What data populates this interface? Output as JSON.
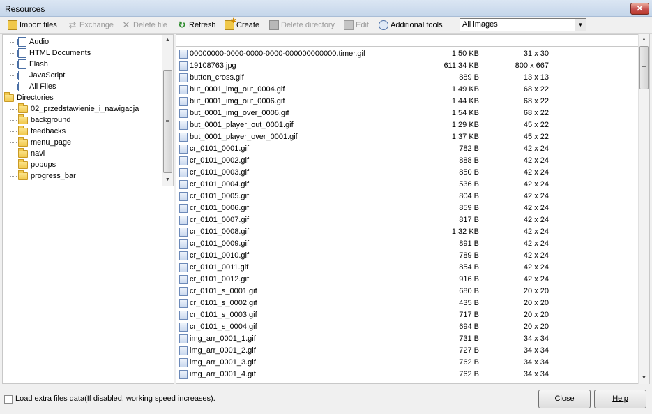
{
  "window": {
    "title": "Resources",
    "close_glyph": "✕"
  },
  "toolbar": {
    "import_files": "Import files",
    "exchange": "Exchange",
    "delete_file": "Delete file",
    "refresh": "Refresh",
    "create": "Create",
    "delete_directory": "Delete directory",
    "edit": "Edit",
    "additional_tools": "Additional tools",
    "filter": {
      "selected": "All images"
    }
  },
  "tree": {
    "file_types": [
      {
        "label": "Audio",
        "icon": "document-icon"
      },
      {
        "label": "HTML Documents",
        "icon": "document-icon"
      },
      {
        "label": "Flash",
        "icon": "document-icon"
      },
      {
        "label": "JavaScript",
        "icon": "document-icon"
      },
      {
        "label": "All Files",
        "icon": "document-icon"
      }
    ],
    "directories_label": "Directories",
    "directories": [
      "02_przedstawienie_i_nawigacja",
      "background",
      "feedbacks",
      "menu_page",
      "navi",
      "popups",
      "progress_bar"
    ]
  },
  "files": [
    {
      "name": "00000000-0000-0000-0000-000000000000.timer.gif",
      "size": "1.50 KB",
      "dims": "31 x 30"
    },
    {
      "name": "19108763.jpg",
      "size": "611.34 KB",
      "dims": "800 x 667"
    },
    {
      "name": "button_cross.gif",
      "size": "889 B",
      "dims": "13 x 13"
    },
    {
      "name": "but_0001_img_out_0004.gif",
      "size": "1.49 KB",
      "dims": "68 x 22"
    },
    {
      "name": "but_0001_img_out_0006.gif",
      "size": "1.44 KB",
      "dims": "68 x 22"
    },
    {
      "name": "but_0001_img_over_0006.gif",
      "size": "1.54 KB",
      "dims": "68 x 22"
    },
    {
      "name": "but_0001_player_out_0001.gif",
      "size": "1.29 KB",
      "dims": "45 x 22"
    },
    {
      "name": "but_0001_player_over_0001.gif",
      "size": "1.37 KB",
      "dims": "45 x 22"
    },
    {
      "name": "cr_0101_0001.gif",
      "size": "782 B",
      "dims": "42 x 24"
    },
    {
      "name": "cr_0101_0002.gif",
      "size": "888 B",
      "dims": "42 x 24"
    },
    {
      "name": "cr_0101_0003.gif",
      "size": "850 B",
      "dims": "42 x 24"
    },
    {
      "name": "cr_0101_0004.gif",
      "size": "536 B",
      "dims": "42 x 24"
    },
    {
      "name": "cr_0101_0005.gif",
      "size": "804 B",
      "dims": "42 x 24"
    },
    {
      "name": "cr_0101_0006.gif",
      "size": "859 B",
      "dims": "42 x 24"
    },
    {
      "name": "cr_0101_0007.gif",
      "size": "817 B",
      "dims": "42 x 24"
    },
    {
      "name": "cr_0101_0008.gif",
      "size": "1.32 KB",
      "dims": "42 x 24"
    },
    {
      "name": "cr_0101_0009.gif",
      "size": "891 B",
      "dims": "42 x 24"
    },
    {
      "name": "cr_0101_0010.gif",
      "size": "789 B",
      "dims": "42 x 24"
    },
    {
      "name": "cr_0101_0011.gif",
      "size": "854 B",
      "dims": "42 x 24"
    },
    {
      "name": "cr_0101_0012.gif",
      "size": "916 B",
      "dims": "42 x 24"
    },
    {
      "name": "cr_0101_s_0001.gif",
      "size": "680 B",
      "dims": "20 x 20"
    },
    {
      "name": "cr_0101_s_0002.gif",
      "size": "435 B",
      "dims": "20 x 20"
    },
    {
      "name": "cr_0101_s_0003.gif",
      "size": "717 B",
      "dims": "20 x 20"
    },
    {
      "name": "cr_0101_s_0004.gif",
      "size": "694 B",
      "dims": "20 x 20"
    },
    {
      "name": "img_arr_0001_1.gif",
      "size": "731 B",
      "dims": "34 x 34"
    },
    {
      "name": "img_arr_0001_2.gif",
      "size": "727 B",
      "dims": "34 x 34"
    },
    {
      "name": "img_arr_0001_3.gif",
      "size": "762 B",
      "dims": "34 x 34"
    },
    {
      "name": "img_arr_0001_4.gif",
      "size": "762 B",
      "dims": "34 x 34"
    }
  ],
  "footer": {
    "load_extra_label": "Load extra files data(If disabled, working speed increases).",
    "close": "Close",
    "help": "Help"
  }
}
